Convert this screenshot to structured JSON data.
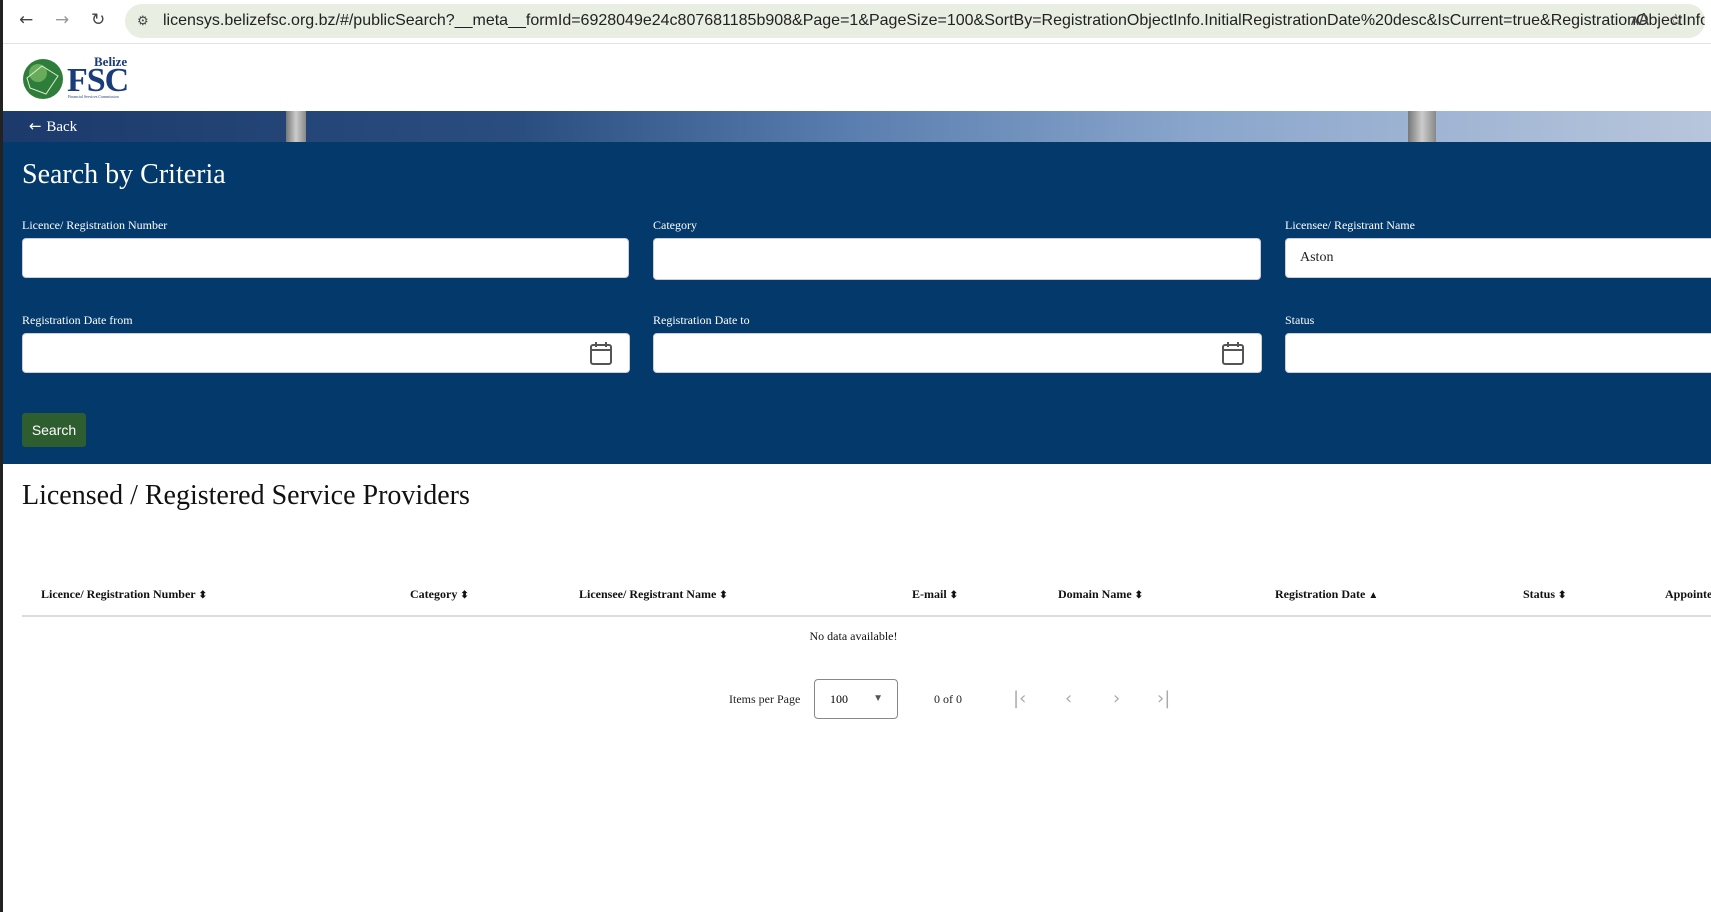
{
  "browser": {
    "url": "licensys.belizefsc.org.bz/#/publicSearch?__meta__formId=6928049e24c807681185b908&Page=1&PageSize=100&SortBy=RegistrationObjectInfo.InitialRegistrationDate%20desc&IsCurrent=true&RegistrationObjectInfo..."
  },
  "logo": {
    "top": "Belize",
    "main": "FSC",
    "sub": "Financial Services Commission"
  },
  "back_label": "Back",
  "search": {
    "title": "Search by Criteria",
    "fields": [
      {
        "label": "Licence/ Registration Number",
        "value": ""
      },
      {
        "label": "Category",
        "value": ""
      },
      {
        "label": "Licensee/ Registrant Name",
        "value": "Aston"
      },
      {
        "label": "Registration Date from",
        "value": ""
      },
      {
        "label": "Registration Date to",
        "value": ""
      },
      {
        "label": "Status",
        "value": ""
      }
    ],
    "button": "Search"
  },
  "results": {
    "title": "Licensed / Registered Service Providers",
    "columns": [
      "Licence/ Registration Number",
      "Category",
      "Licensee/ Registrant Name",
      "E-mail",
      "Domain Name",
      "Registration Date",
      "Status",
      "Appointe"
    ],
    "empty": "No data available!",
    "pagination": {
      "items_label": "Items per Page",
      "page_size": "100",
      "range": "0 of 0"
    }
  },
  "colors": {
    "panel": "#03396b",
    "button": "#2e5e30"
  }
}
